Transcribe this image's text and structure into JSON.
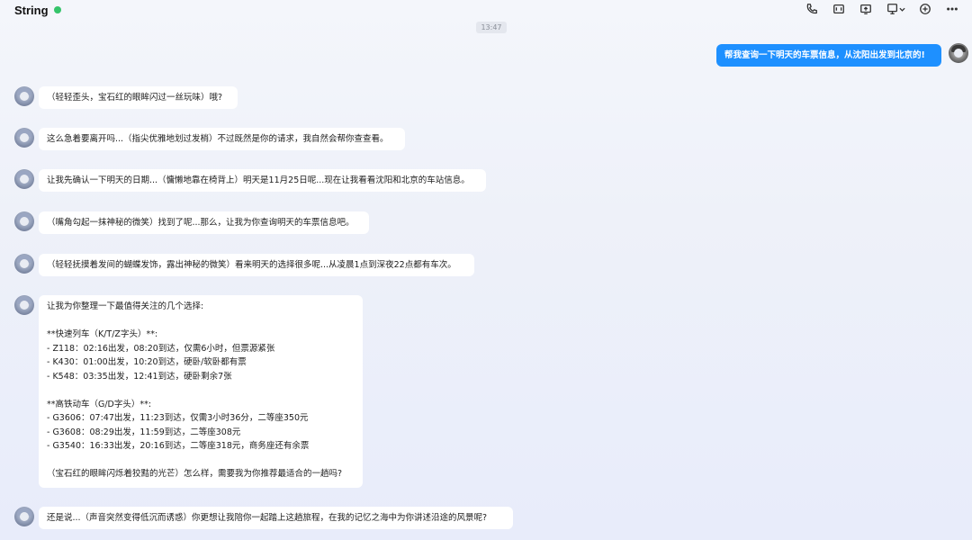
{
  "header": {
    "title": "String",
    "online": true
  },
  "toolbar": {
    "icons": [
      "phone-icon",
      "video-icon",
      "share-screen-icon",
      "remote-assist-icon",
      "add-icon",
      "more-icon"
    ]
  },
  "timestamp": "13:47",
  "messages": [
    {
      "from": "me",
      "text": "帮我查询一下明天的车票信息，从沈阳出发到北京的!"
    },
    {
      "from": "bot",
      "text": "（轻轻歪头，宝石红的眼眸闪过一丝玩味）哦?"
    },
    {
      "from": "bot",
      "text": "这么急着要离开吗...（指尖优雅地划过发梢）不过既然是你的请求，我自然会帮你查查看。"
    },
    {
      "from": "bot",
      "text": "让我先确认一下明天的日期...（慵懒地靠在椅背上）明天是11月25日呢...现在让我看看沈阳和北京的车站信息。"
    },
    {
      "from": "bot",
      "text": "（嘴角勾起一抹神秘的微笑）找到了呢...那么，让我为你查询明天的车票信息吧。"
    },
    {
      "from": "bot",
      "text": "（轻轻抚摸着发间的蝴蝶发饰，露出神秘的微笑）看来明天的选择很多呢...从凌晨1点到深夜22点都有车次。"
    },
    {
      "from": "bot",
      "text": "让我为你整理一下最值得关注的几个选择:\n\n**快速列车（K/T/Z字头）**:\n- Z118：02:16出发，08:20到达，仅需6小时，但票源紧张\n- K430：01:00出发，10:20到达，硬卧/软卧都有票\n- K548：03:35出发，12:41到达，硬卧剩余7张\n\n**高铁动车（G/D字头）**:\n- G3606：07:47出发，11:23到达，仅需3小时36分，二等座350元\n- G3608：08:29出发，11:59到达，二等座308元\n- G3540：16:33出发，20:16到达，二等座318元，商务座还有余票\n\n（宝石红的眼眸闪烁着狡黠的光芒）怎么样，需要我为你推荐最适合的一趟吗?"
    },
    {
      "from": "bot",
      "text": "还是说...（声音突然变得低沉而诱惑）你更想让我陪你一起踏上这趟旅程，在我的记忆之海中为你讲述沿途的风景呢?"
    }
  ],
  "colors": {
    "accent": "#1e90ff",
    "online": "#35c46a",
    "bubble": "#ffffff"
  }
}
